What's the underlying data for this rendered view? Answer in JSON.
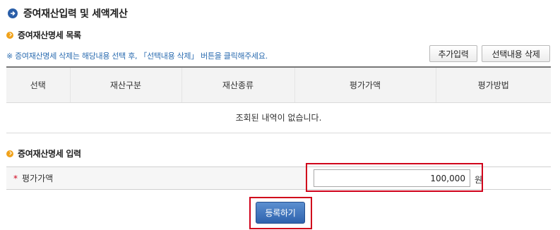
{
  "page": {
    "title": "증여재산입력 및 세액계산",
    "title_icon": "arrow-right-circle-icon"
  },
  "list_section": {
    "title": "증여재산명세 목록",
    "notice": "※ 증여재산명세 삭제는 해당내용 선택 후, 「선택내용 삭제」 버튼을 클릭해주세요.",
    "add_button": "추가입력",
    "delete_button": "선택내용 삭제",
    "columns": [
      "선택",
      "재산구분",
      "재산종류",
      "평가가액",
      "평가방법"
    ],
    "empty_message": "조회된 내역이 없습니다."
  },
  "input_section": {
    "title": "증여재산명세 입력",
    "field_required_mark": "*",
    "field_label": "평가가액",
    "field_value": "100,000",
    "field_unit": "원"
  },
  "submit_button": "등록하기",
  "colors": {
    "accent_blue": "#2a5ea8",
    "section_bullet": "#f0a21b",
    "highlight_red": "#d0021b",
    "notice_text": "#2b6cb0"
  }
}
